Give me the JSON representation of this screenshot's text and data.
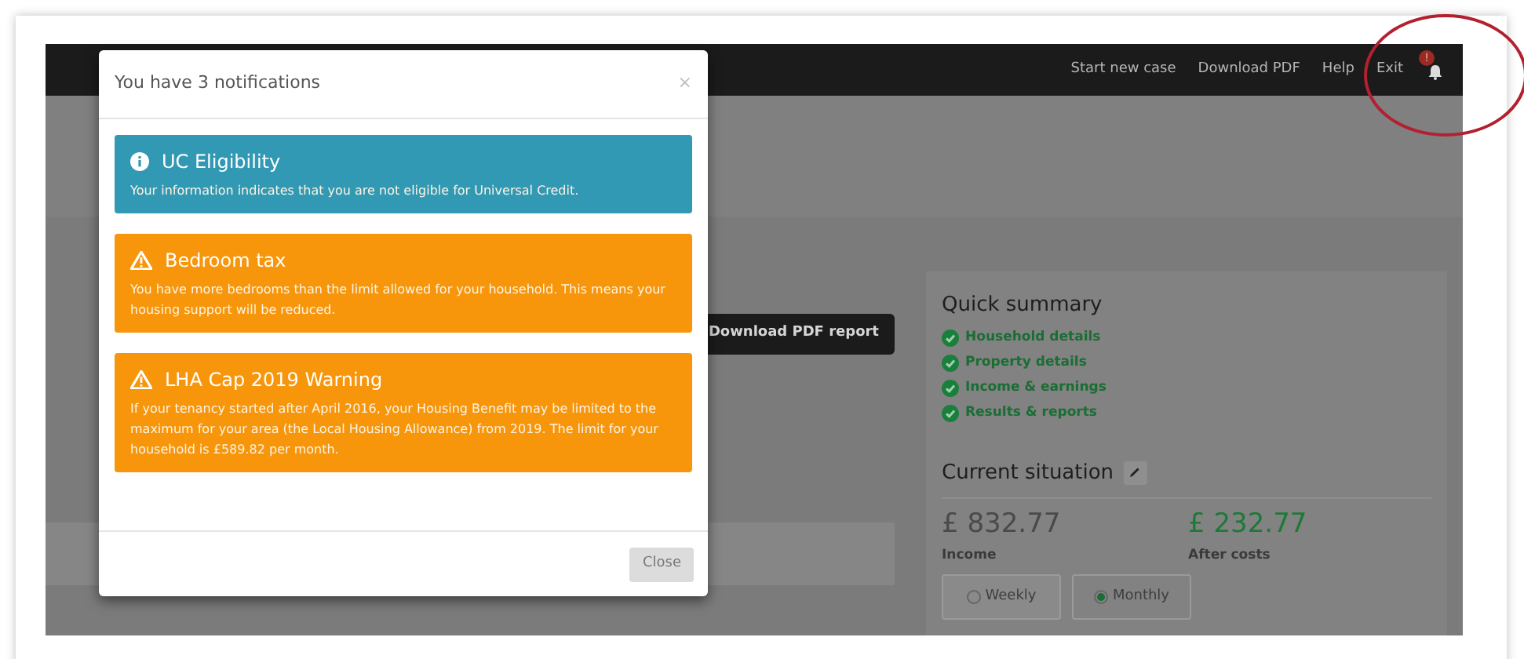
{
  "nav": {
    "links": [
      "Start new case",
      "Download PDF",
      "Help",
      "Exit"
    ],
    "badge": "!"
  },
  "page": {
    "download_button": "Download PDF report",
    "quick_summary": {
      "title": "Quick summary",
      "items": [
        {
          "label": "Household details",
          "checked": true
        },
        {
          "label": "Property details",
          "checked": true
        },
        {
          "label": "Income & earnings",
          "checked": true
        },
        {
          "label": "Results & reports",
          "checked": true
        }
      ]
    },
    "current_situation": {
      "title": "Current situation",
      "income": {
        "amount": "£ 832.77",
        "label": "Income"
      },
      "after_costs": {
        "amount": "£ 232.77",
        "label": "After costs"
      },
      "periods": [
        {
          "label": "Weekly",
          "selected": false
        },
        {
          "label": "Monthly",
          "selected": true
        }
      ]
    }
  },
  "modal": {
    "title": "You have 3 notifications",
    "close_icon": "×",
    "notifications": [
      {
        "kind": "info",
        "title": "UC Eligibility",
        "text": "Your information indicates that you are not eligible for Universal Credit."
      },
      {
        "kind": "warning",
        "title": "Bedroom tax",
        "text": "You have more bedrooms than the limit allowed for your household. This means your housing support will be reduced."
      },
      {
        "kind": "warning",
        "title": "LHA Cap 2019 Warning",
        "text": "If your tenancy started after April 2016, your Housing Benefit may be limited to the maximum for your area (the Local Housing Allowance) from 2019. The limit for your household is £589.82 per month."
      }
    ],
    "close_button": "Close"
  }
}
